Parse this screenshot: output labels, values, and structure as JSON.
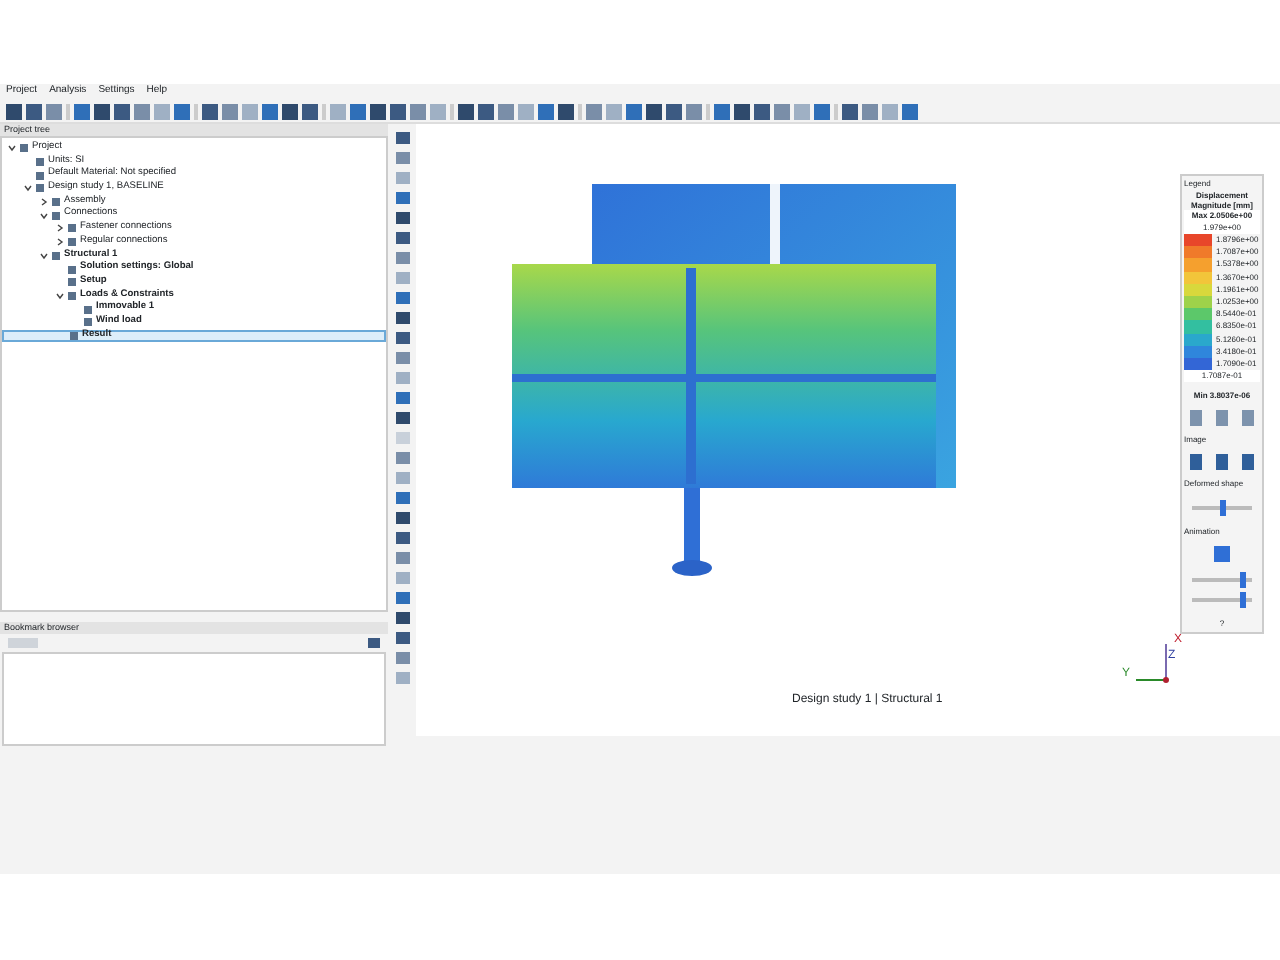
{
  "menu": [
    "Project",
    "Analysis",
    "Settings",
    "Help"
  ],
  "project_tree": {
    "title": "Project tree",
    "items": [
      {
        "label": "Project",
        "bold": false,
        "expanded": true,
        "selected": false,
        "children": [
          {
            "label": "Units: SI",
            "bold": false,
            "selected": false
          },
          {
            "label": "Default Material: Not specified",
            "bold": false,
            "selected": false
          },
          {
            "label": "Design study 1, BASELINE",
            "bold": false,
            "expanded": true,
            "selected": false,
            "children": [
              {
                "label": "Assembly",
                "bold": false,
                "expanded": false,
                "selected": false
              },
              {
                "label": "Connections",
                "bold": false,
                "expanded": true,
                "selected": false,
                "children": [
                  {
                    "label": "Fastener connections",
                    "bold": false,
                    "expanded": false,
                    "selected": false
                  },
                  {
                    "label": "Regular connections",
                    "bold": false,
                    "expanded": false,
                    "selected": false
                  }
                ]
              },
              {
                "label": "Structural 1",
                "bold": true,
                "expanded": true,
                "selected": false,
                "children": [
                  {
                    "label": "Solution settings: Global",
                    "bold": true,
                    "selected": false
                  },
                  {
                    "label": "Setup",
                    "bold": true,
                    "selected": false
                  },
                  {
                    "label": "Loads & Constraints",
                    "bold": true,
                    "expanded": true,
                    "selected": false,
                    "children": [
                      {
                        "label": "Immovable 1",
                        "bold": true,
                        "selected": false
                      },
                      {
                        "label": "Wind load",
                        "bold": true,
                        "selected": false
                      }
                    ]
                  },
                  {
                    "label": "Result",
                    "bold": true,
                    "selected": true
                  }
                ]
              }
            ]
          }
        ]
      }
    ]
  },
  "bookmark_browser": {
    "title": "Bookmark browser"
  },
  "viewport": {
    "caption": "Design study 1 | Structural 1",
    "axis_x": "X",
    "axis_y": "Y",
    "axis_z": "Z"
  },
  "legend": {
    "title": "Legend",
    "heading": "Displacement\nMagnitude [mm]",
    "max": "Max  2.0506e+00",
    "top_value": "1.979e+00",
    "scale": [
      {
        "value": "1.8796e+00",
        "color": "#e8462a"
      },
      {
        "value": "1.7087e+00",
        "color": "#f07a2a"
      },
      {
        "value": "1.5378e+00",
        "color": "#f5a02e"
      },
      {
        "value": "1.3670e+00",
        "color": "#f2c53a"
      },
      {
        "value": "1.1961e+00",
        "color": "#d8d83c"
      },
      {
        "value": "1.0253e+00",
        "color": "#9ed24a"
      },
      {
        "value": "8.5440e-01",
        "color": "#5cc86a"
      },
      {
        "value": "6.8350e-01",
        "color": "#33bfa0"
      },
      {
        "value": "5.1260e-01",
        "color": "#2aa8cc"
      },
      {
        "value": "3.4180e-01",
        "color": "#2f86dc"
      },
      {
        "value": "1.7090e-01",
        "color": "#3366d6"
      }
    ],
    "bottom_value": "1.7087e-01",
    "min": "Min  3.8037e-06",
    "image_label": "Image",
    "deformed_label": "Deformed shape",
    "animation_label": "Animation",
    "animation_on": true,
    "deform_slider": {
      "level": 0.5
    },
    "speed_slider": {
      "level": 0.85
    },
    "frames_slider": {
      "level": 0.85
    },
    "help": "?"
  }
}
